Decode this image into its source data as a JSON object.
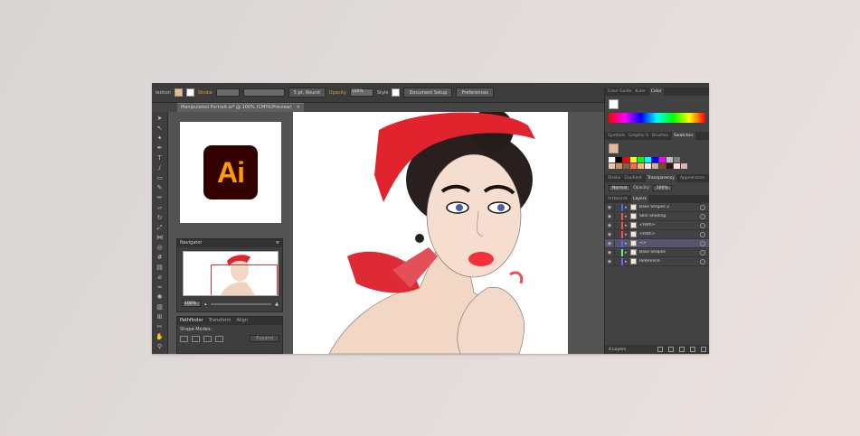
{
  "control_bar": {
    "selection_label": "lection",
    "stroke_label": "Stroke",
    "brush_value": "5 pt. Round",
    "opacity_label": "Opacity",
    "opacity_value": "100%",
    "style_label": "Style",
    "document_setup": "Document Setup",
    "preferences": "Preferences"
  },
  "document_tab": {
    "title": "Manipulated Portrait.ai* @ 100% (CMYK/Preview)",
    "close": "×"
  },
  "logo": {
    "text": "Ai",
    "bg_color": "#330000",
    "fg_color": "#ff9a00"
  },
  "navigator": {
    "title": "Navigator",
    "zoom": "100%"
  },
  "pathfinder": {
    "tabs": [
      "Pathfinder",
      "Transform",
      "Align"
    ],
    "shape_modes_label": "Shape Modes:",
    "expand_label": "Expand"
  },
  "color_panel": {
    "tabs": [
      "Color Guide",
      "Kuler",
      "Color"
    ]
  },
  "swatches_panel": {
    "tabs": [
      "Symbols",
      "Graphic S",
      "Brushes",
      "Swatches"
    ]
  },
  "transparency_panel": {
    "tabs": [
      "Stroke",
      "Gradient",
      "Transparency",
      "Appearance"
    ],
    "blend_mode": "Normal",
    "opacity_label": "Opacity:",
    "opacity_value": "100%"
  },
  "layers_panel": {
    "tabs": [
      "Artboards",
      "Layers"
    ],
    "layers": [
      {
        "name": "Base Shapes 2",
        "color": "#4b6bff",
        "selected": false
      },
      {
        "name": "Skin Shading",
        "color": "#ff4b4b",
        "selected": false
      },
      {
        "name": "<Path>",
        "color": "#ff4b4b",
        "selected": false
      },
      {
        "name": "<Path>",
        "color": "#ff4b4b",
        "selected": false
      },
      {
        "name": "<>",
        "color": "#4b6bff",
        "selected": true
      },
      {
        "name": "Base Shapes",
        "color": "#4bff6b",
        "selected": false
      },
      {
        "name": "Reference",
        "color": "#a04bff",
        "selected": false
      }
    ],
    "count": "4 Layers"
  },
  "swatch_colors": [
    "#ffffff",
    "#000000",
    "#ff0000",
    "#ffff00",
    "#00ff00",
    "#00ffff",
    "#0000ff",
    "#ff00ff",
    "#c0c0c0",
    "#808080",
    "#404040",
    "#e8c8a8",
    "#c8906a",
    "#8c5a3c",
    "#ff6a4b",
    "#ffb27a",
    "#f4e7d7",
    "#d0b090",
    "#7a4a2a",
    "#3a1a0a",
    "#ffe0e0",
    "#e0b0b0"
  ]
}
